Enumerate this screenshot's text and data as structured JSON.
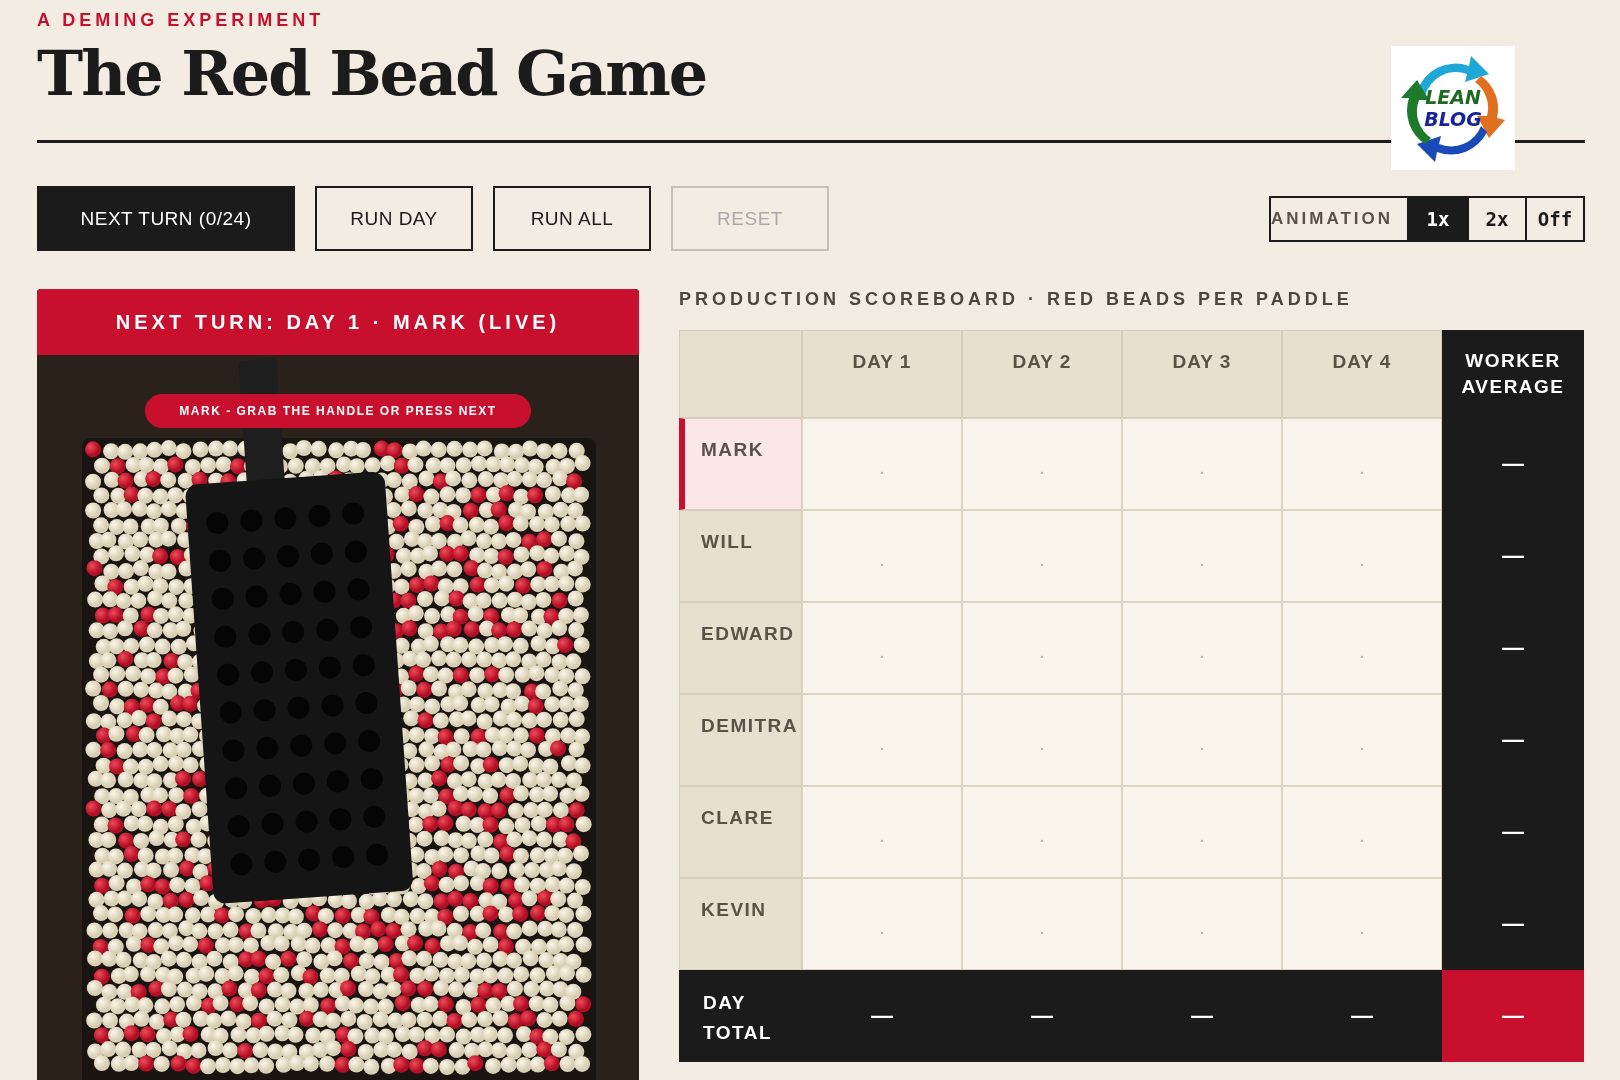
{
  "header": {
    "eyebrow": "A DEMING EXPERIMENT",
    "title": "The Red Bead Game",
    "logo": {
      "line_1": "LEAN",
      "line_2": "BLOG"
    }
  },
  "controls": [
    {
      "label": "NEXT TURN (0/24)",
      "kind": "primary",
      "disabled": false
    },
    {
      "label": "RUN DAY",
      "kind": "outline",
      "disabled": false
    },
    {
      "label": "RUN ALL",
      "kind": "outline",
      "disabled": false
    },
    {
      "label": "RESET",
      "kind": "outline",
      "disabled": true
    }
  ],
  "animation": {
    "label": "ANIMATION",
    "options": [
      {
        "label": "1x",
        "selected": true
      },
      {
        "label": "2x",
        "selected": false
      },
      {
        "label": "Off",
        "selected": false
      }
    ]
  },
  "paddle_panel": {
    "banner": "NEXT TURN: DAY 1 · MARK (LIVE)",
    "hint": "MARK - GRAB THE HANDLE OR PRESS NEXT"
  },
  "scoreboard": {
    "title": "PRODUCTION SCOREBOARD · RED BEADS PER PADDLE",
    "columns": [
      "DAY 1",
      "DAY 2",
      "DAY 3",
      "DAY 4"
    ],
    "average_column": "WORKER AVERAGE",
    "rows": [
      {
        "name": "MARK",
        "selected": true,
        "cells": [
          "·",
          "·",
          "·",
          "·"
        ],
        "average": "—"
      },
      {
        "name": "WILL",
        "selected": false,
        "cells": [
          "·",
          "·",
          "·",
          "·"
        ],
        "average": "—"
      },
      {
        "name": "EDWARD",
        "selected": false,
        "cells": [
          "·",
          "·",
          "·",
          "·"
        ],
        "average": "—"
      },
      {
        "name": "DEMITRA",
        "selected": false,
        "cells": [
          "·",
          "·",
          "·",
          "·"
        ],
        "average": "—"
      },
      {
        "name": "CLARE",
        "selected": false,
        "cells": [
          "·",
          "·",
          "·",
          "·"
        ],
        "average": "—"
      },
      {
        "name": "KEVIN",
        "selected": false,
        "cells": [
          "·",
          "·",
          "·",
          "·"
        ],
        "average": "—"
      }
    ],
    "total": {
      "label": "DAY TOTAL",
      "cells": [
        "—",
        "—",
        "—",
        "—"
      ],
      "overall": "—"
    }
  }
}
